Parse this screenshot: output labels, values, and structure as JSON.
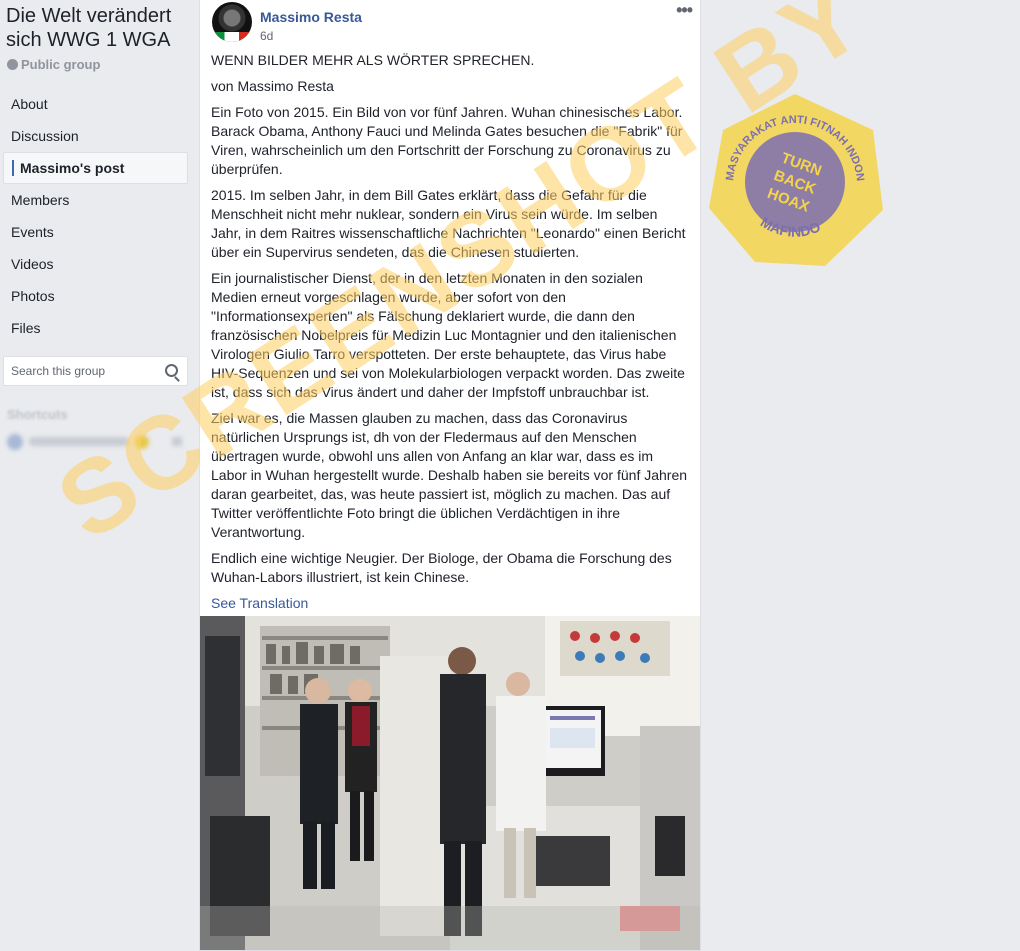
{
  "sidebar": {
    "group_title": "Die Welt verändert sich WWG 1 WGA",
    "group_type": "Public group",
    "nav": [
      {
        "label": "About",
        "active": false
      },
      {
        "label": "Discussion",
        "active": false
      },
      {
        "label": "Massimo's post",
        "active": true
      },
      {
        "label": "Members",
        "active": false
      },
      {
        "label": "Events",
        "active": false
      },
      {
        "label": "Videos",
        "active": false
      },
      {
        "label": "Photos",
        "active": false
      },
      {
        "label": "Files",
        "active": false
      }
    ],
    "search_placeholder": "Search this group",
    "shortcuts_label": "Shortcuts"
  },
  "post": {
    "author": "Massimo Resta",
    "time": "6d",
    "more_icon": "ellipsis-icon",
    "paragraphs": [
      "WENN BILDER MEHR ALS WÖRTER SPRECHEN.",
      "von Massimo Resta",
      "Ein Foto von 2015. Ein Bild von vor fünf Jahren. Wuhan chinesisches Labor. Barack Obama, Anthony Fauci und Melinda Gates besuchen die \"Fabrik\" für Viren, wahrscheinlich um den Fortschritt der Forschung zu Coronavirus zu überprüfen.",
      "2015. Im selben Jahr, in dem Bill Gates erklärt, dass die Gefahr für die Menschheit nicht mehr nuklear, sondern ein Virus sein würde. Im selben Jahr, in dem Raitres wissenschaftliche Nachrichten \"Leonardo\" einen Bericht über ein Supervirus sendeten, das die Chinesen studierten.",
      "Ein journalistischer Dienst, der in den letzten Monaten in den sozialen Medien erneut vorgeschlagen wurde, aber sofort von den \"Informationsexperten\" als Fälschung deklariert wurde, die dann den französischen Nobelpreis für Medizin Luc Montagnier und den italienischen Virologen Giulio Tarro verspotteten. Der erste behauptete, das Virus habe HIV-Sequenzen und sei von Molekularbiologen verpackt worden. Das zweite ist, dass sich das Virus ändert und daher der Impfstoff unbrauchbar ist.",
      "Ziel war es, die Massen glauben zu machen, dass das Coronavirus natürlichen Ursprungs ist, dh von der Fledermaus auf den Menschen übertragen wurde, obwohl uns allen von Anfang an klar war, dass es im Labor in Wuhan hergestellt wurde. Deshalb haben sie bereits vor fünf Jahren daran gearbeitet, das, was heute passiert ist, möglich zu machen. Das auf Twitter veröffentlichte Foto bringt die üblichen Verdächtigen in ihre Verantwortung.",
      "Endlich eine wichtige Neugier. Der Biologe, der Obama die Forschung des Wuhan-Labors illustriert, ist kein Chinese."
    ],
    "see_translation": "See Translation"
  },
  "overlay": {
    "watermark": "SCREENSHOT BY",
    "badge_ring_top": "MASYARAKAT ANTI FITNAH INDONESIA",
    "badge_ring_bottom": "MAFINDO",
    "badge_center": [
      "TURN",
      "BACK",
      "HOAX"
    ],
    "watermark_color": "#ffcd5f",
    "badge_color": "#f5d44a",
    "badge_inner_color": "#7b6fb0"
  }
}
